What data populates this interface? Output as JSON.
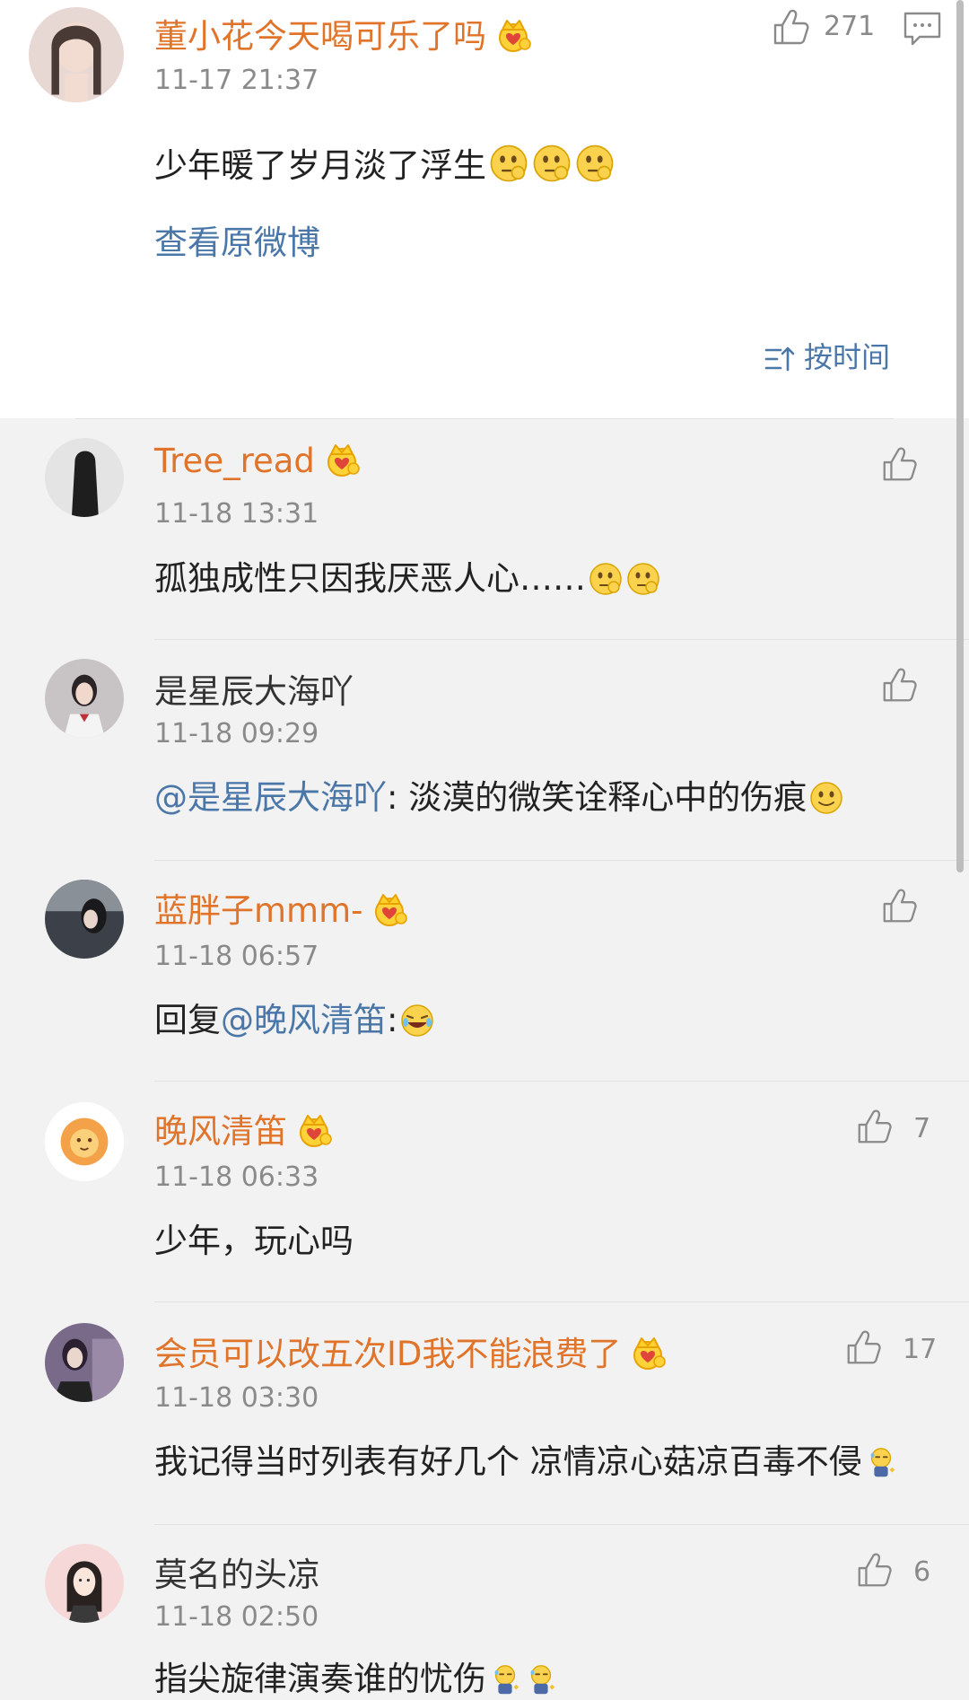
{
  "post": {
    "author": "董小花今天喝可乐了吗",
    "time": "11-17 21:37",
    "text": "少年暖了岁月淡了浮生",
    "like_count": "271",
    "view_original": "查看原微博",
    "sort_label": "按时间"
  },
  "comments": [
    {
      "name": "Tree_read",
      "vip": true,
      "time": "11-18 13:31",
      "mention": "",
      "text": "孤独成性只因我厌恶人心……",
      "likes": ""
    },
    {
      "name": "是星辰大海吖",
      "vip": false,
      "time": "11-18 09:29",
      "mention": "@是星辰大海吖",
      "text": ": 淡漠的微笑诠释心中的伤痕",
      "likes": ""
    },
    {
      "name": "蓝胖子mmm-",
      "vip": true,
      "time": "11-18 06:57",
      "prefix": "回复",
      "mention": "@晚风清笛",
      "text": ":",
      "likes": ""
    },
    {
      "name": "晚风清笛",
      "vip": true,
      "time": "11-18 06:33",
      "mention": "",
      "text": "少年，玩心吗",
      "likes": "7"
    },
    {
      "name": "会员可以改五次ID我不能浪费了",
      "vip": true,
      "time": "11-18 03:30",
      "mention": "",
      "text": "我记得当时列表有好几个 凉情凉心菇凉百毒不侵",
      "likes": "17"
    },
    {
      "name": "莫名的头凉",
      "vip": false,
      "time": "11-18 02:50",
      "mention": "",
      "text": "指尖旋律演奏谁的忧伤",
      "likes": "6"
    }
  ],
  "colors": {
    "name_vip": "#e0742a",
    "link": "#4a77a8",
    "time": "#8a8a8a",
    "bg": "#f2f2f2"
  },
  "icons": [
    "thumbs-up-icon",
    "comment-icon",
    "sort-icon",
    "vip-crown-icon",
    "emoji-icon"
  ]
}
